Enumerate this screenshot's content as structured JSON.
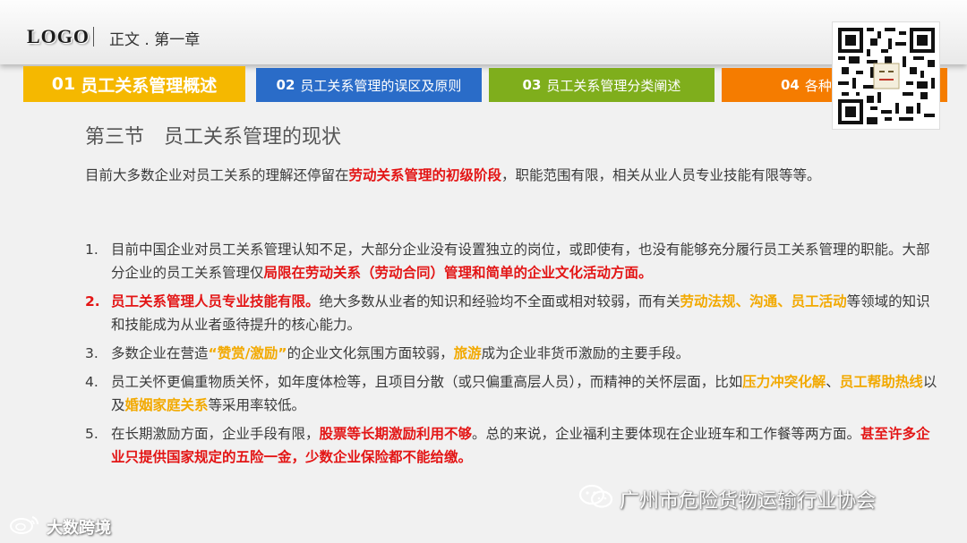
{
  "header": {
    "logo": "LOGO",
    "chapter": "正文 . 第一章"
  },
  "tabs": [
    {
      "num": "01",
      "label": "员工关系管理概述",
      "color": "#f5b800"
    },
    {
      "num": "02",
      "label": "员工关系管理的误区及原则",
      "color": "#2a6cc8"
    },
    {
      "num": "03",
      "label": "员工关系管理分类阐述",
      "color": "#7fae1c"
    },
    {
      "num": "04",
      "label": "各种",
      "color": "#f57c00"
    }
  ],
  "qr_icon": "qr-code",
  "section_title": "第三节　员工关系管理的现状",
  "intro": {
    "before": "目前大多数企业对员工关系的理解还停留在",
    "highlight": "劳动关系管理的初级阶段",
    "after": "，职能范围有限，相关从业人员专业技能有限等等。"
  },
  "list": [
    {
      "num": "1.",
      "t1": "目前中国企业对员工关系管理认知不足，大部分企业没有设置独立的岗位，或即使有，也没有能够充分履行员工关系管理的职能。大部分企业的员工关系管理仅",
      "h1": "局限在劳动关系（劳动合同）管理和简单的企业文化活动方面。"
    },
    {
      "num": "2.",
      "h1": "员工关系管理人员专业技能有限。",
      "t1": "绝大多数从业者的知识和经验均不全面或相对较弱，而有关",
      "g1": "劳动法规",
      "s1": "、",
      "g2": "沟通",
      "s2": "、",
      "g3": "员工活动",
      "t2": "等领域的知识和技能成为从业者亟待提升的核心能力。"
    },
    {
      "num": "3.",
      "t1": "多数企业在营造",
      "g1": "“赞赏/激励”",
      "t2": "的企业文化氛围方面较弱，",
      "g2": "旅游",
      "t3": "成为企业非货币激励的主要手段。"
    },
    {
      "num": "4.",
      "t1": "员工关怀更偏重物质关怀，如年度体检等，且项目分散（或只偏重高层人员），而精神的关怀层面，比如",
      "g1": "压力冲突化解",
      "s1": "、",
      "g2": "员工帮助热线",
      "t2": "以及",
      "g3": "婚姻家庭关系",
      "t3": "等采用率较低。"
    },
    {
      "num": "5.",
      "t1": "在长期激励方面，企业手段有限，",
      "h1": "股票等长期激励利用不够",
      "t2": "。总的来说，企业福利主要体现在企业班车和工作餐等两方面。",
      "h2": "甚至许多企业只提供国家规定的五险一金，少数企业保险都不能给缴。"
    }
  ],
  "watermarks": {
    "wechat_icon": "wechat-icon",
    "wechat_text": "广州市危险货物运输行业协会",
    "dashu_icon": "weibo-icon",
    "dashu_text": "大数跨境"
  }
}
